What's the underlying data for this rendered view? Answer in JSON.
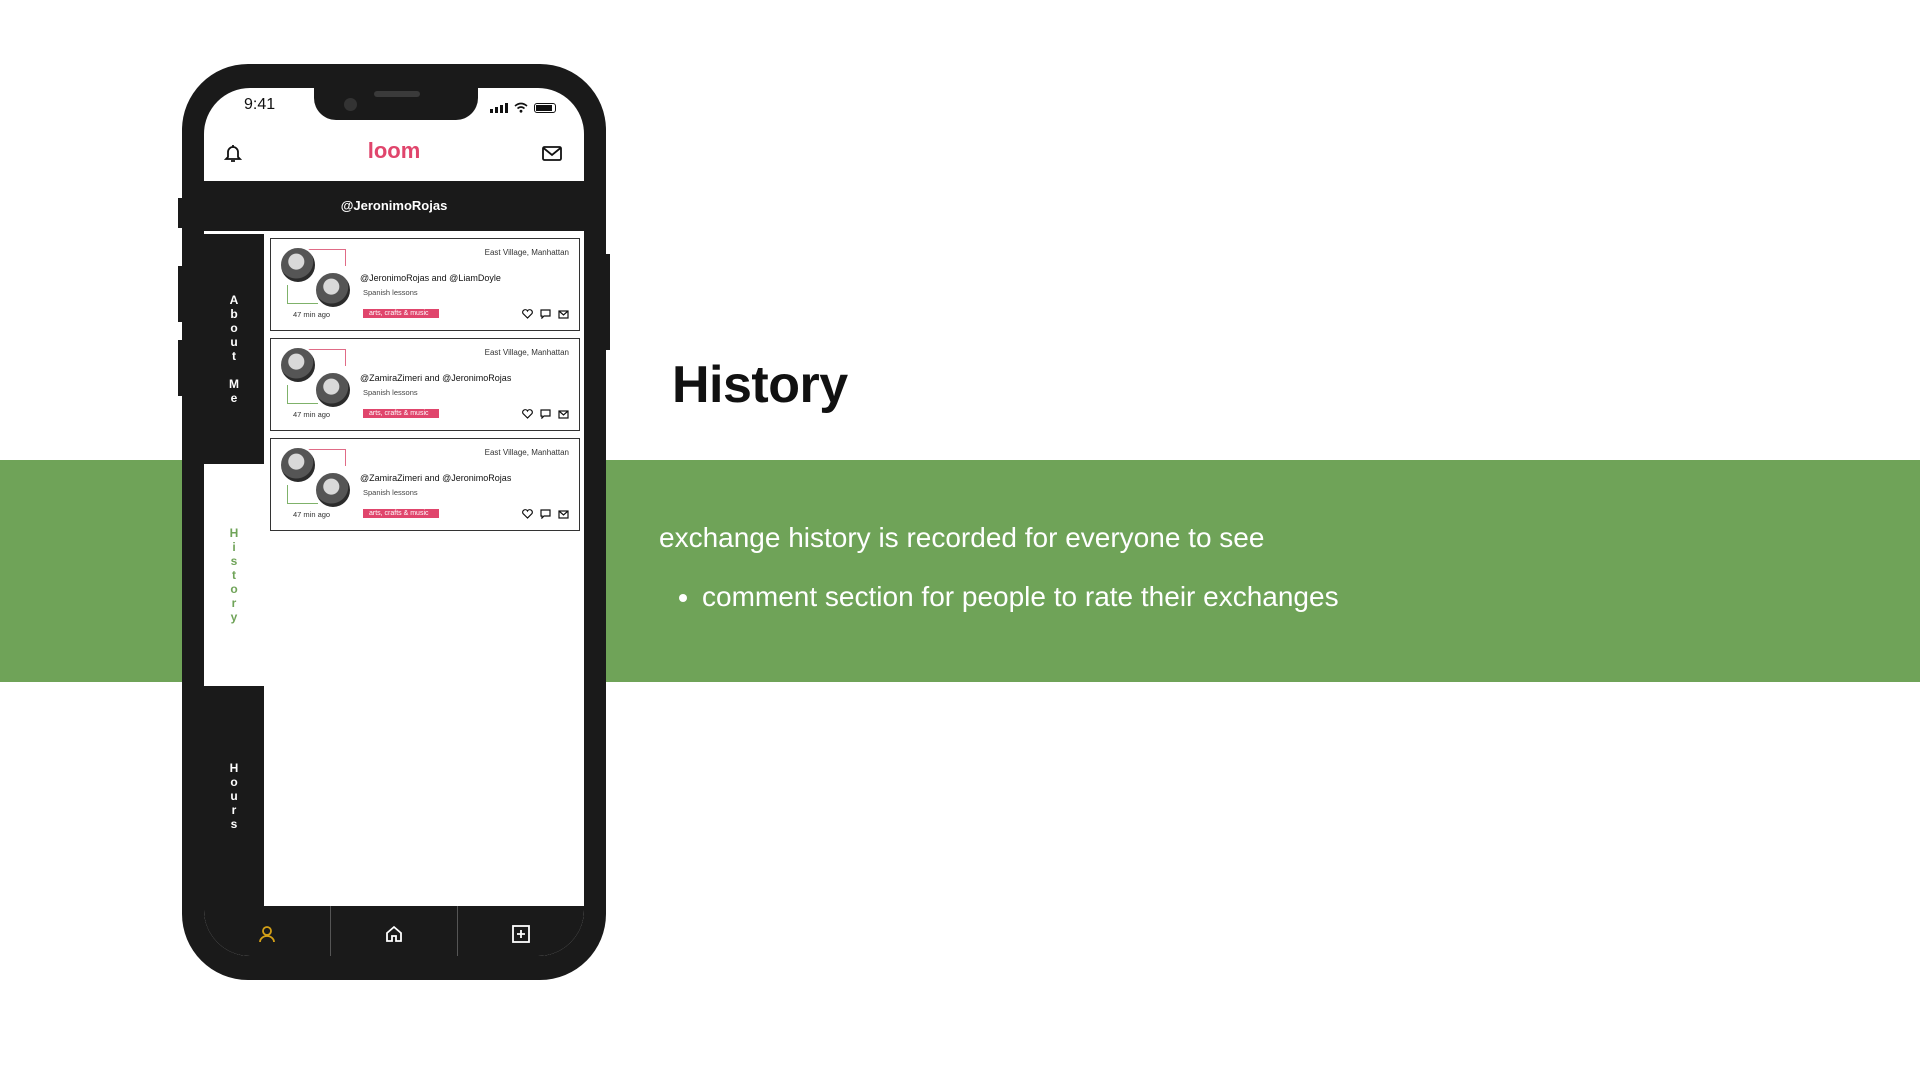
{
  "slide": {
    "title": "History",
    "description": "exchange history is recorded for everyone to see",
    "bullets": [
      "comment section for people to rate their exchanges"
    ],
    "band_color": "#6fa358"
  },
  "phone": {
    "status_time": "9:41",
    "app_logo": "loom",
    "username": "@JeronimoRojas",
    "side_tabs": [
      {
        "label": "About Me",
        "state": "inactive"
      },
      {
        "label": "History",
        "state": "active"
      },
      {
        "label": "Hours",
        "state": "inactive"
      }
    ],
    "cards": [
      {
        "location": "East Village, Manhattan",
        "names": "@JeronimoRojas and @LiamDoyle",
        "lesson": "Spanish lessons",
        "tag": "arts, crafts & music",
        "time": "47 min ago"
      },
      {
        "location": "East Village, Manhattan",
        "names": "@ZamiraZimeri and @JeronimoRojas",
        "lesson": "Spanish lessons",
        "tag": "arts, crafts & music",
        "time": "47 min ago"
      },
      {
        "location": "East Village, Manhattan",
        "names": "@ZamiraZimeri and @JeronimoRojas",
        "lesson": "Spanish lessons",
        "tag": "arts, crafts & music",
        "time": "47 min ago"
      }
    ],
    "icons": {
      "bell": "bell-icon",
      "mail": "mail-icon",
      "heart": "heart-icon",
      "comment": "comment-icon",
      "message": "message-icon",
      "profile": "profile-icon",
      "home": "home-icon",
      "add": "add-icon"
    },
    "colors": {
      "accent_green": "#6fa358",
      "tag_pink": "#e0456c",
      "nav_dark": "#1a1a1a",
      "profile_active": "#d4a017"
    }
  }
}
